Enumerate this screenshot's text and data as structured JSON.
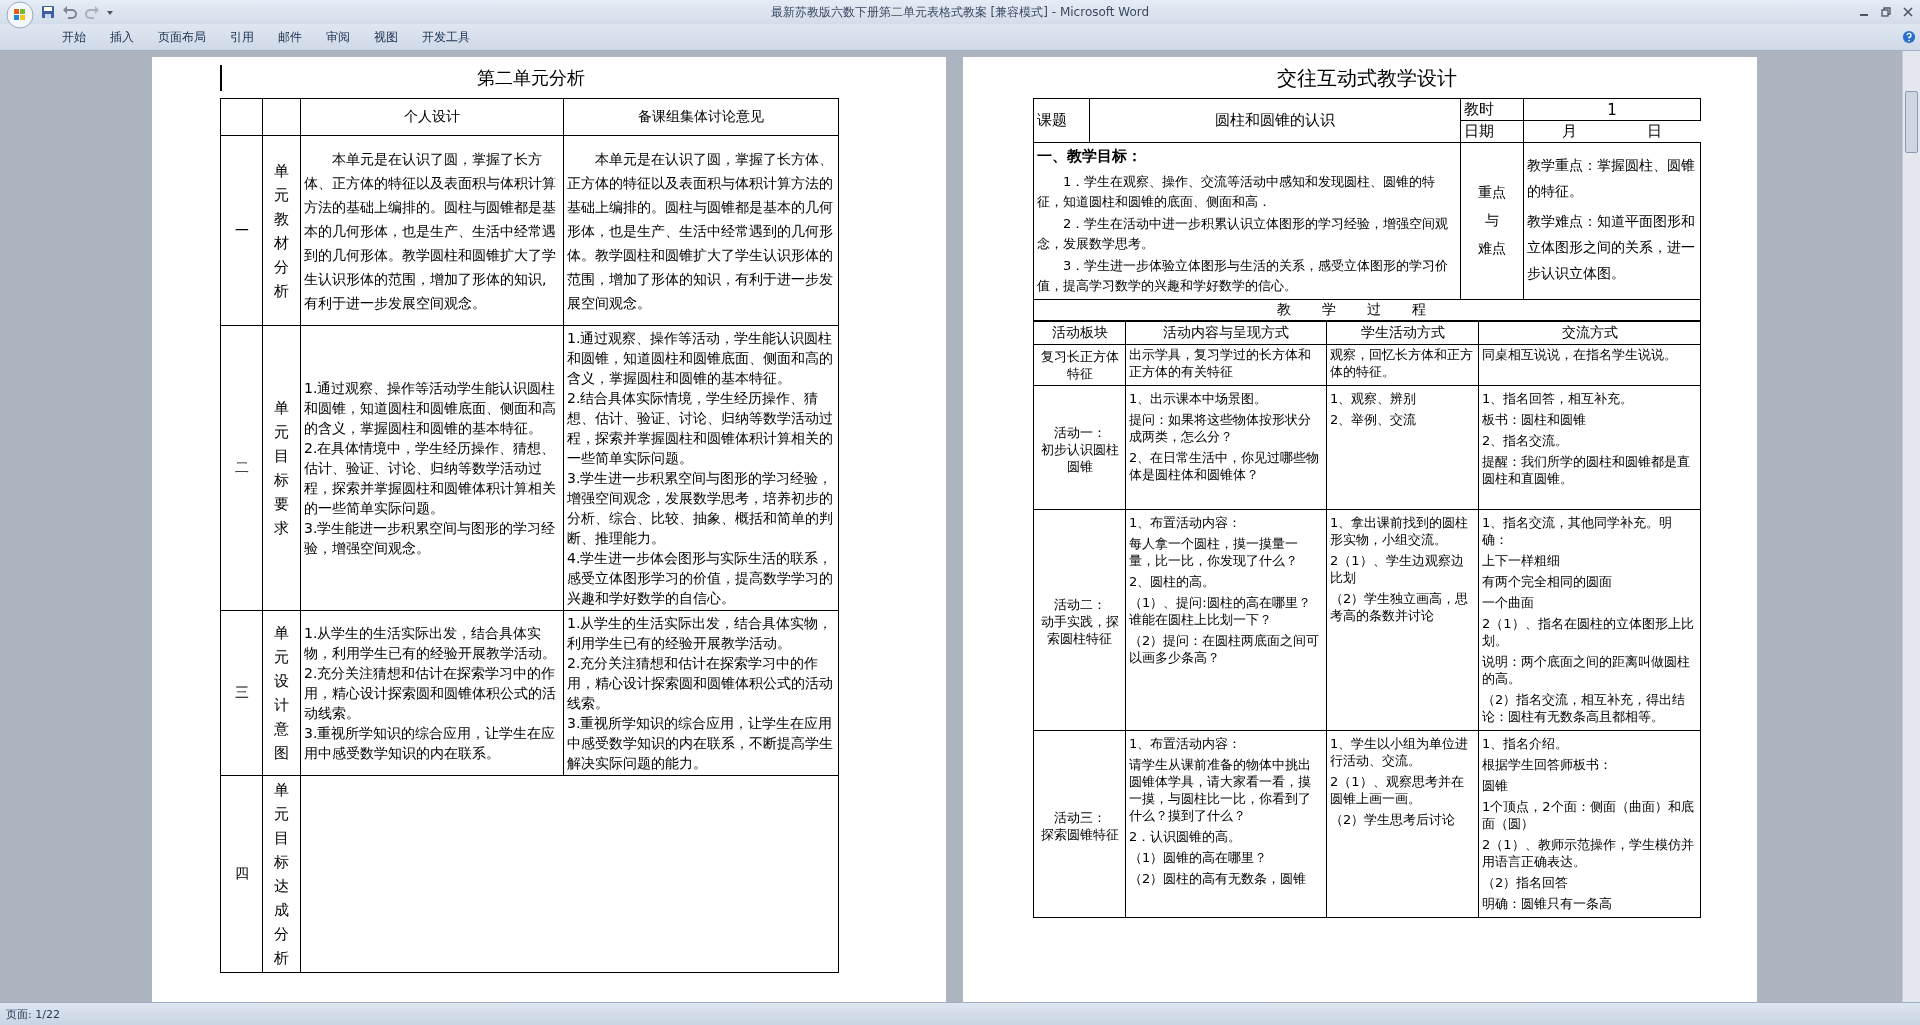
{
  "window": {
    "title": "最新苏教版六数下册第二单元表格式教案 [兼容模式] - Microsoft Word"
  },
  "ribbon_tabs": [
    {
      "label": "开始",
      "selected": false
    },
    {
      "label": "插入",
      "selected": false
    },
    {
      "label": "页面布局",
      "selected": false
    },
    {
      "label": "引用",
      "selected": false
    },
    {
      "label": "邮件",
      "selected": false
    },
    {
      "label": "审阅",
      "selected": false
    },
    {
      "label": "视图",
      "selected": false
    },
    {
      "label": "开发工具",
      "selected": false
    }
  ],
  "left_page": {
    "heading": "第二单元分析",
    "columns": [
      "个人设计",
      "备课组集体讨论意见"
    ],
    "rows": [
      {
        "number": "一",
        "label": "单元教材分析",
        "personal": [
          "本单元是在认识了圆，掌握了长方体、正方体的特征以及表面积与体积计算方法的基础上编排的。圆柱与圆锥都是基本的几何形体，也是生产、生活中经常遇到的几何形体。教学圆柱和圆锥扩大了学生认识形体的范围，增加了形体的知识,有利于进一步发展空间观念。"
        ],
        "group": [
          "本单元是在认识了圆，掌握了长方体、正方体的特征以及表面积与体积计算方法的基础上编排的。圆柱与圆锥都是基本的几何形体，也是生产、生活中经常遇到的几何形体。教学圆柱和圆锥扩大了学生认识形体的范围，增加了形体的知识，有利于进一步发展空间观念。"
        ]
      },
      {
        "number": "二",
        "label": "单元目标要求",
        "personal": [
          "1.通过观察、操作等活动学生能认识圆柱和圆锥，知道圆柱和圆锥底面、侧面和高的含义，掌握圆柱和圆锥的基本特征。",
          "2.在具体情境中，学生经历操作、猜想、估计、验证、讨论、归纳等数学活动过程，探索并掌握圆柱和圆锥体积计算相关的一些简单实际问题。",
          "3.学生能进一步积累空间与图形的学习经验，增强空间观念。"
        ],
        "group": [
          "1.通过观察、操作等活动，学生能认识圆柱和圆锥，知道圆柱和圆锥底面、侧面和高的含义，掌握圆柱和圆锥的基本特征。",
          "2.结合具体实际情境，学生经历操作、猜想、估计、验证、讨论、归纳等数学活动过程，探索并掌握圆柱和圆锥体积计算相关的一些简单实际问题。",
          "3.学生进一步积累空间与图形的学习经验，增强空间观念，发展数学思考，培养初步的分析、综合、比较、抽象、概括和简单的判断、推理能力。",
          "4.学生进一步体会图形与实际生活的联系，感受立体图形学习的价值，提高数学学习的兴趣和学好数学的自信心。"
        ]
      },
      {
        "number": "三",
        "label": "单元设计意图",
        "personal": [
          "1.从学生的生活实际出发，结合具体实物，利用学生已有的经验开展教学活动。",
          "2.充分关注猜想和估计在探索学习中的作用，精心设计探索圆和圆锥体积公式的活动线索。",
          "3.重视所学知识的综合应用，让学生在应用中感受数学知识的内在联系。"
        ],
        "group": [
          "1.从学生的生活实际出发，结合具体实物，利用学生已有的经验开展教学活动。",
          "2.充分关注猜想和估计在探索学习中的作用，精心设计探索圆和圆锥体积公式的活动线索。",
          "3.重视所学知识的综合应用，让学生在应用中感受数学知识的内在联系，不断提高学生解决实际问题的能力。"
        ]
      },
      {
        "number": "四",
        "label": "单元目标达成分析"
      }
    ]
  },
  "right_page": {
    "heading": "交往互动式教学设计",
    "subject_label": "课题",
    "subject": "圆柱和圆锥的认识",
    "period_label": "教时",
    "period": "1",
    "date_label": "日期",
    "date_month": "月",
    "date_day": "日",
    "objectives_heading": "一、教学目标：",
    "objectives": [
      "1．学生在观察、操作、交流等活动中感知和发现圆柱、圆锥的特征，知道圆柱和圆锥的底面、侧面和高．",
      "2．学生在活动中进一步积累认识立体图形的学习经验，增强空间观念，发展数学思考。",
      "3．学生进一步体验立体图形与生活的关系，感受立体图形的学习价值，提高学习数学的兴趣和学好数学的信心。"
    ],
    "focus_label": [
      "重点",
      "与",
      "难点"
    ],
    "focus": [
      "教学重点：掌握圆柱、圆锥的特征。",
      "教学难点：知道平面图形和立体图形之间的关系，进一步认识立体图。"
    ],
    "process_heading": "教学过程",
    "columns": [
      "活动板块",
      "活动内容与呈现方式",
      "学生活动方式",
      "交流方式"
    ],
    "rows": [
      {
        "block": [
          "复习长正方体特征"
        ],
        "content": [
          "出示学具，复习学过的长方体和正方体的有关特征"
        ],
        "student": [
          "观察，回忆长方体和正方体的特征。"
        ],
        "exchange": [
          "同桌相互说说，在指名学生说说。"
        ]
      },
      {
        "block": [
          "活动一：",
          "初步认识圆柱圆锥"
        ],
        "content": [
          "1、出示课本中场景图。",
          "提问：如果将这些物体按形状分成两类，怎么分？",
          "2、在日常生活中，你见过哪些物体是圆柱体和圆锥体？"
        ],
        "student": [
          "1、观察、辨别",
          "2、举例、交流"
        ],
        "exchange": [
          "1、指名回答，相互补充。",
          "板书：圆柱和圆锥",
          "2、指名交流。",
          "提醒：我们所学的圆柱和圆锥都是直圆柱和直圆锥。"
        ]
      },
      {
        "block": [
          "活动二：",
          "动手实践，探索圆柱特征"
        ],
        "content": [
          "1、布置活动内容：",
          "每人拿一个圆柱，摸一摸量一量，比一比，你发现了什么？",
          "2、圆柱的高。",
          "（1）、提问:圆柱的高在哪里？谁能在圆柱上比划一下？",
          "（2）提问：在圆柱两底面之间可以画多少条高？"
        ],
        "student": [
          "1、拿出课前找到的圆柱形实物，小组交流。",
          "2（1）、学生边观察边比划",
          "（2）学生独立画高，思考高的条数并讨论"
        ],
        "exchange": [
          "1、指名交流，其他同学补充。明确：",
          "上下一样粗细",
          "有两个完全相同的圆面",
          "一个曲面",
          "2（1）、指名在圆柱的立体图形上比划。",
          "说明：两个底面之间的距离叫做圆柱的高。",
          "（2）指名交流，相互补充，得出结论：圆柱有无数条高且都相等。"
        ]
      },
      {
        "block": [
          "活动三：",
          "探索圆锥特征"
        ],
        "content": [
          "1、布置活动内容：",
          "请学生从课前准备的物体中挑出圆锥体学具，请大家看一看，摸一摸，与圆柱比一比，你看到了什么？摸到了什么？",
          "2．认识圆锥的高。",
          "（1）圆锥的高在哪里？",
          "（2）圆柱的高有无数条，圆锥"
        ],
        "student": [
          "1、学生以小组为单位进行活动、交流。",
          "2（1）、观察思考并在圆锥上画一画。",
          "（2）学生思考后讨论"
        ],
        "exchange": [
          "1、指名介绍。",
          "根据学生回答师板书：",
          "圆锥",
          "1个顶点，2个面：侧面（曲面）和底面（圆）",
          "2（1）、教师示范操作，学生模仿并用语言正确表达。",
          "（2）指名回答",
          "明确：圆锥只有一条高"
        ]
      }
    ]
  },
  "status_bar": {
    "page": "页面: 1/22"
  }
}
